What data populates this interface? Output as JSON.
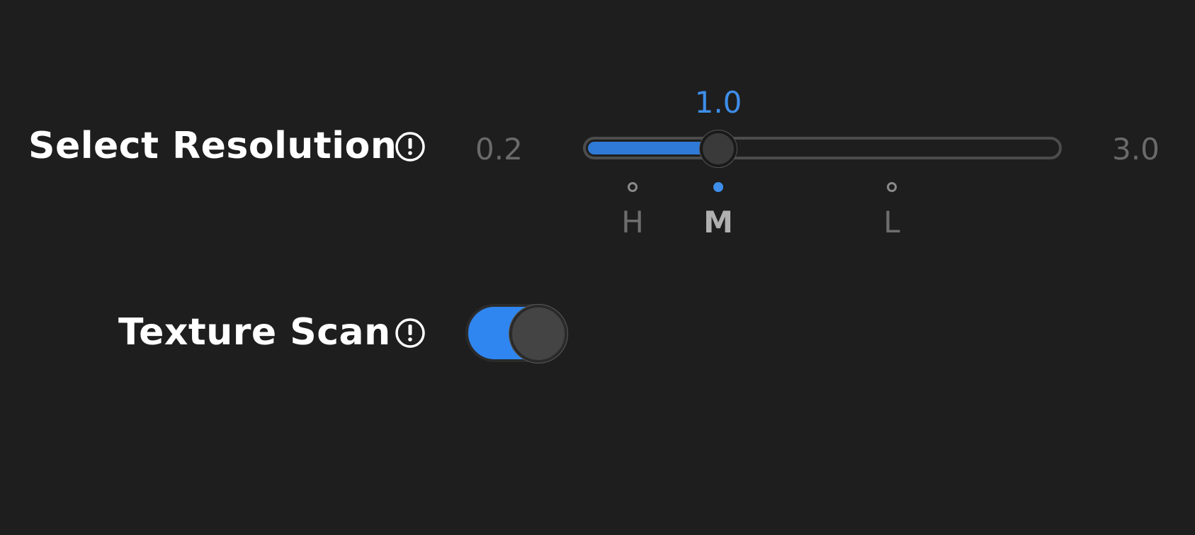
{
  "settings": {
    "resolution": {
      "label": "Select Resolution",
      "info_icon": "info-circle-icon",
      "min_label": "0.2",
      "max_label": "3.0",
      "value_label": "1.0",
      "min": 0.2,
      "max": 3.0,
      "value": 1.0,
      "presets": [
        {
          "label": "H",
          "active": false
        },
        {
          "label": "M",
          "active": true
        },
        {
          "label": "L",
          "active": false
        }
      ]
    },
    "texture": {
      "label": "Texture Scan",
      "info_icon": "info-circle-icon",
      "enabled": true
    }
  },
  "colors": {
    "background": "#1e1e1e",
    "accent": "#3e8eea",
    "text": "#ffffff",
    "muted": "#6a6a6a"
  }
}
